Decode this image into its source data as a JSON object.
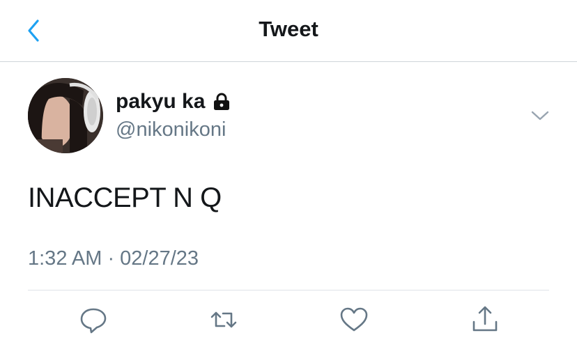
{
  "header": {
    "title": "Tweet"
  },
  "tweet": {
    "display_name": "pakyu ka",
    "handle": "@nikonikoni",
    "text": "INACCEPT N Q",
    "timestamp": "1:32 AM · 02/27/23"
  },
  "icons": {
    "back": "chevron-left-icon",
    "lock": "lock-icon",
    "more": "chevron-down-icon",
    "reply": "reply-icon",
    "retweet": "retweet-icon",
    "like": "heart-icon",
    "share": "share-icon"
  },
  "colors": {
    "accent": "#1da1f2",
    "secondary_text": "#657786",
    "primary_text": "#14171a"
  }
}
